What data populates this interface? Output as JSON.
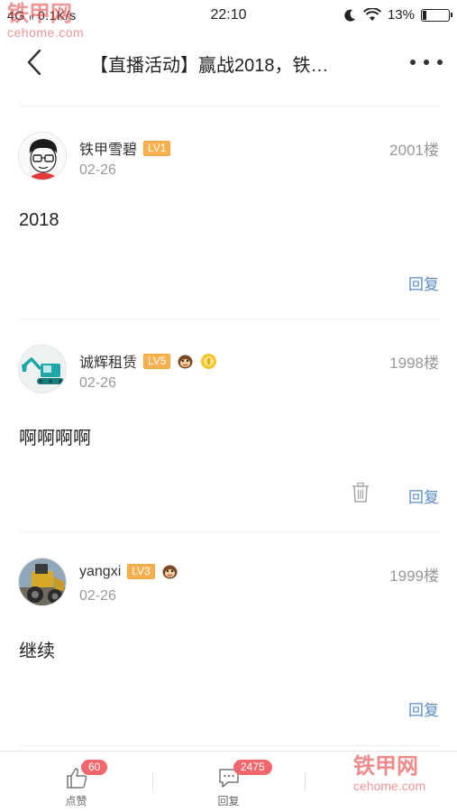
{
  "status_bar": {
    "network": "4G",
    "speed": "0.1K/s",
    "time": "22:10",
    "battery": "13%"
  },
  "watermark": {
    "name": "铁甲网",
    "site": "cehome.com"
  },
  "nav": {
    "title": "【直播活动】赢战2018，铁…"
  },
  "posts": [
    {
      "username": "铁甲雪碧",
      "level": "LV1",
      "floor": "2001楼",
      "date": "02-26",
      "content": "2018",
      "reply_label": "回复"
    },
    {
      "username": "诚辉租赁",
      "level": "LV5",
      "floor": "1998楼",
      "date": "02-26",
      "content": "啊啊啊啊",
      "reply_label": "回复"
    },
    {
      "username": "yangxi",
      "level": "LV3",
      "floor": "1999楼",
      "date": "02-26",
      "content": "继续",
      "reply_label": "回复"
    }
  ],
  "bottom_bar": {
    "like": {
      "label": "点赞",
      "count": "60"
    },
    "reply": {
      "label": "回复",
      "count": "2475"
    }
  },
  "colors": {
    "accent_blue": "#5b8ec4",
    "level_badge": "#f7b04f",
    "count_badge": "#f1676b",
    "watermark_red": "#e13c3c"
  },
  "icons": {
    "back": "back-icon",
    "more": "more-icon",
    "delete": "trash-icon",
    "like": "thumbs-up-icon",
    "reply": "comment-icon"
  }
}
